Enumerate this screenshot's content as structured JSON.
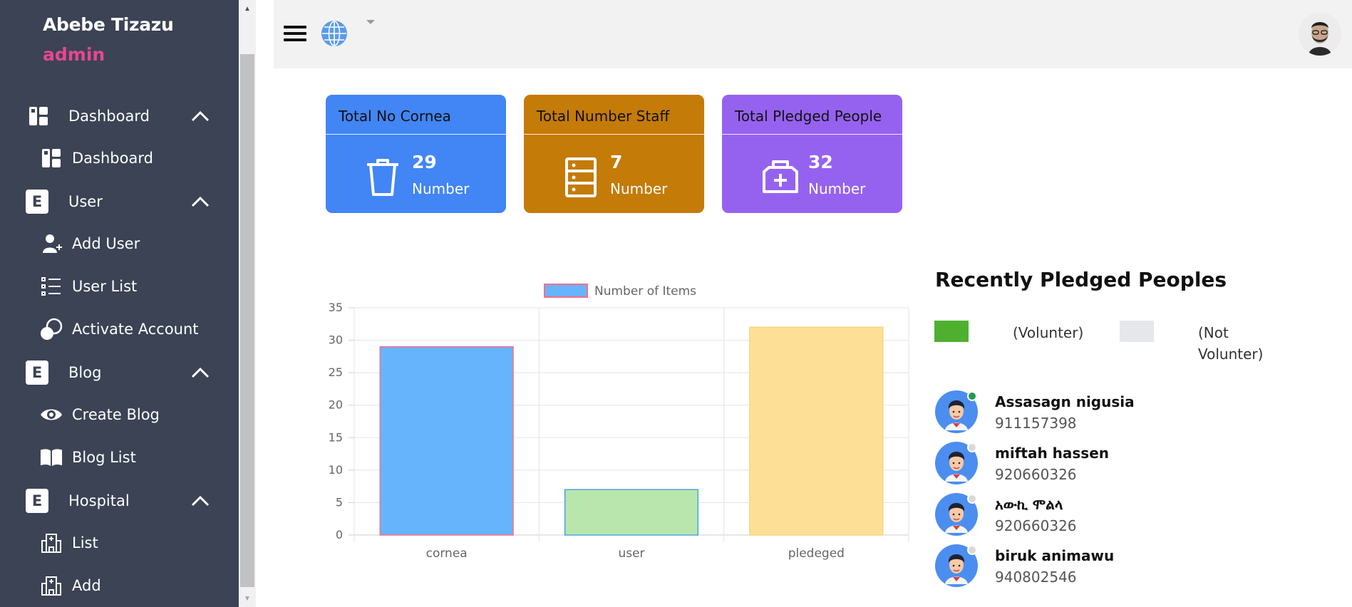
{
  "sidebar": {
    "user_name": "Abebe Tizazu",
    "user_role": "admin",
    "items": [
      {
        "label": "Dashboard",
        "icon": "dashboard-icon",
        "type": "group"
      },
      {
        "label": "Dashboard",
        "icon": "dashboard-icon",
        "type": "item"
      },
      {
        "label": "User",
        "icon": "e-badge-icon",
        "type": "group"
      },
      {
        "label": "Add User",
        "icon": "add-user-icon",
        "type": "item"
      },
      {
        "label": "User List",
        "icon": "list-icon",
        "type": "item"
      },
      {
        "label": "Activate Account",
        "icon": "toggle-icon",
        "type": "item"
      },
      {
        "label": "Blog",
        "icon": "e-badge-icon",
        "type": "group"
      },
      {
        "label": "Create Blog",
        "icon": "eye-icon",
        "type": "item"
      },
      {
        "label": "Blog List",
        "icon": "book-icon",
        "type": "item"
      },
      {
        "label": "Hospital",
        "icon": "e-badge-icon",
        "type": "group"
      },
      {
        "label": "List",
        "icon": "hospital-icon",
        "type": "item"
      },
      {
        "label": "Add",
        "icon": "hospital-icon",
        "type": "item"
      }
    ],
    "group_badge": "E"
  },
  "topbar": {
    "menu_icon": "hamburger-icon",
    "language_icon": "globe-icon",
    "dropdown_icon": "caret-down-icon"
  },
  "cards": [
    {
      "title": "Total No Cornea",
      "value": "29",
      "unit": "Number",
      "color": "#4285f4",
      "icon": "trash-icon"
    },
    {
      "title": "Total Number Staff",
      "value": "7",
      "unit": "Number",
      "color": "#c47b08",
      "icon": "cabinet-icon"
    },
    {
      "title": "Total Pledged People",
      "value": "32",
      "unit": "Number",
      "color": "#9562f0",
      "icon": "medkit-icon"
    }
  ],
  "chart_data": {
    "type": "bar",
    "categories": [
      "cornea",
      "user",
      "pledeged"
    ],
    "series": [
      {
        "name": "Number of Items",
        "values": [
          29,
          7,
          32
        ]
      }
    ],
    "bar_colors": [
      "#66b5fc",
      "#b8e6ad",
      "#fde095"
    ],
    "bar_borders": [
      "#ff6b8a",
      "#4aa3e0",
      "#fdd27a"
    ],
    "ylim": [
      0,
      35
    ],
    "yticks": [
      0,
      5,
      10,
      15,
      20,
      25,
      30,
      35
    ],
    "grid": true,
    "legend": "top"
  },
  "recent": {
    "title": "Recently Pledged Peoples",
    "legend": [
      {
        "label": "(Volunter)",
        "color": "#4fb030"
      },
      {
        "label": "(Not Volunter)",
        "label_lines": [
          "(Not",
          "Volunter)"
        ],
        "color": "#e5e7eb"
      }
    ],
    "people": [
      {
        "name": "Assasagn nigusia",
        "phone": "911157398",
        "volunteer": true
      },
      {
        "name": "miftah hassen",
        "phone": "920660326",
        "volunteer": false
      },
      {
        "name": "አውኪ ሞልላ",
        "phone": "920660326",
        "volunteer": false
      },
      {
        "name": "biruk animawu",
        "phone": "940802546",
        "volunteer": false
      }
    ]
  }
}
